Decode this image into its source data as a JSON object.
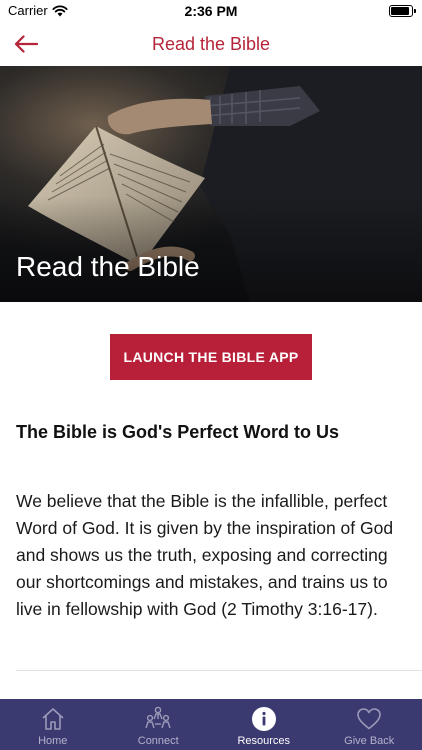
{
  "status_bar": {
    "carrier": "Carrier",
    "time": "2:36 PM",
    "battery_level": 0.9
  },
  "nav": {
    "title": "Read the Bible",
    "back_icon": "arrow-left-icon"
  },
  "hero": {
    "title": "Read the Bible"
  },
  "launch_button": {
    "label": "LAUNCH THE BIBLE APP"
  },
  "content": {
    "heading": "The Bible is God's Perfect Word to Us",
    "body": "We believe that the Bible is the infallible, perfect Word of God. It is given by the inspiration of God and shows us the truth, exposing and correcting our shortcomings and mistakes, and trains us to live in fellowship with God (2 Timothy 3:16-17)."
  },
  "tabs": [
    {
      "label": "Home",
      "icon": "home-icon",
      "active": false
    },
    {
      "label": "Connect",
      "icon": "people-icon",
      "active": false
    },
    {
      "label": "Resources",
      "icon": "info-icon",
      "active": true
    },
    {
      "label": "Give Back",
      "icon": "heart-icon",
      "active": false
    }
  ],
  "colors": {
    "accent": "#b5253a",
    "button": "#b81f38",
    "tab_bar": "#3b3a70"
  }
}
